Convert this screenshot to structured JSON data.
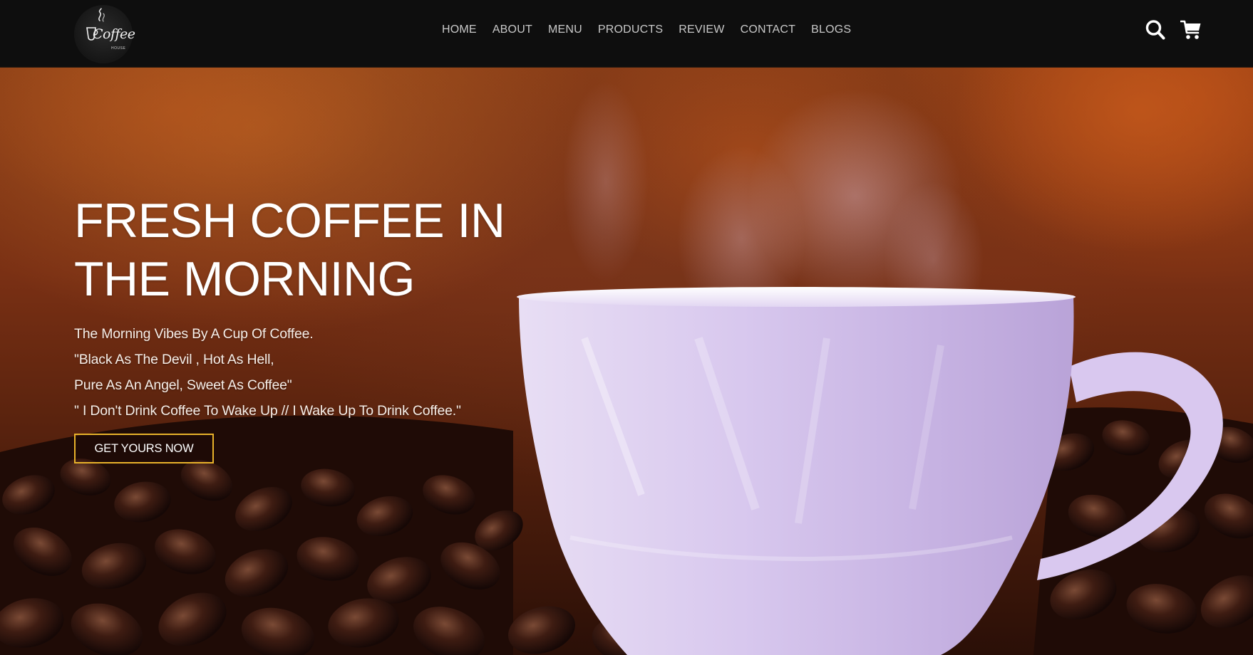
{
  "brand": {
    "logo_word": "Coffee",
    "logo_sub": "HOUSE"
  },
  "nav": {
    "items": [
      "HOME",
      "ABOUT",
      "MENU",
      "PRODUCTS",
      "REVIEW",
      "CONTACT",
      "BLOGS"
    ]
  },
  "icons": {
    "search": "search-icon",
    "cart": "cart-icon"
  },
  "hero": {
    "title_line1": "FRESH COFFEE IN",
    "title_line2": "THE MORNING",
    "lines": [
      "The Morning Vibes By A Cup Of Coffee.",
      "\"Black As The Devil , Hot As Hell,",
      "Pure As An Angel, Sweet As Coffee\"",
      "\" I Don't Drink Coffee To Wake Up // I Wake Up To Drink Coffee.\""
    ],
    "cta_label": "GET YOURS NOW"
  },
  "colors": {
    "header_bg": "#0e0e0e",
    "nav_text": "#c9c9c9",
    "cta_border": "#e8b22a",
    "hero_warm": "#8a3d16"
  }
}
